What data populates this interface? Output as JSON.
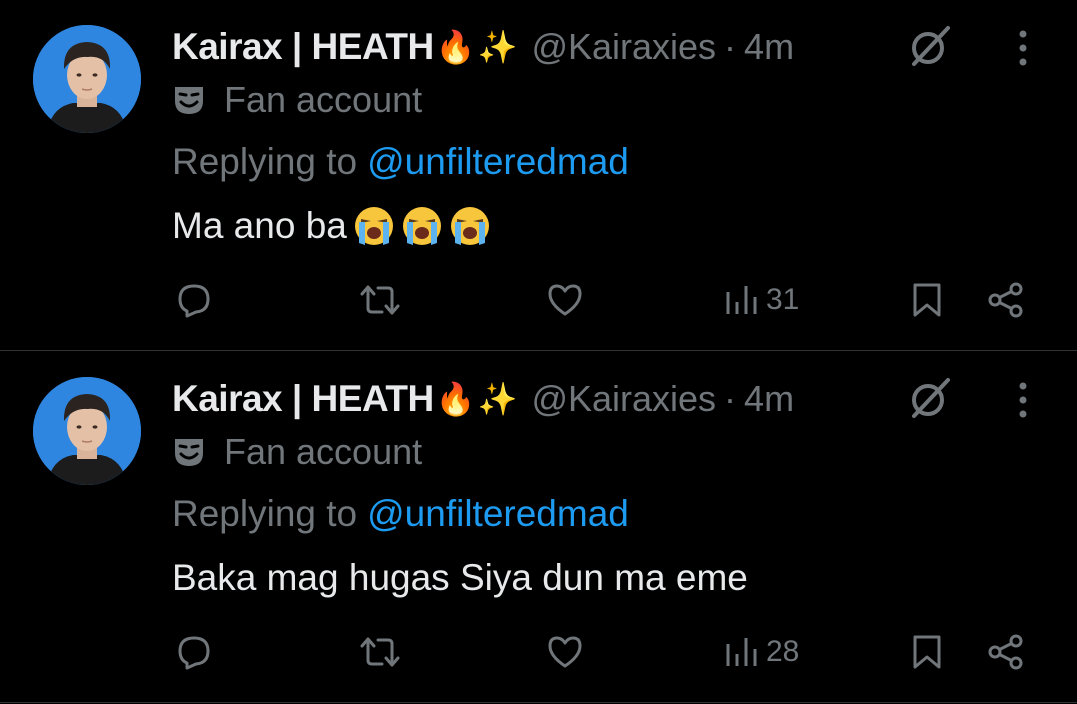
{
  "tweets": [
    {
      "display_name": "Kairax | HEATH",
      "name_emojis": [
        "🔥",
        "✨"
      ],
      "handle": "@Kairaxies",
      "separator": "·",
      "time": "4m",
      "label": "Fan account",
      "reply_prefix": "Replying to",
      "reply_handle": "@unfilteredmad",
      "text": "Ma ano ba",
      "text_emojis": [
        "loudly-crying-face",
        "loudly-crying-face",
        "loudly-crying-face"
      ],
      "views": "31"
    },
    {
      "display_name": "Kairax | HEATH",
      "name_emojis": [
        "🔥",
        "✨"
      ],
      "handle": "@Kairaxies",
      "separator": "·",
      "time": "4m",
      "label": "Fan account",
      "reply_prefix": "Replying to",
      "reply_handle": "@unfilteredmad",
      "text": "Baka mag hugas Siya dun ma eme",
      "text_emojis": [],
      "views": "28"
    }
  ],
  "icons": {
    "grok": "grok-icon",
    "more": "more-vertical-icon",
    "label": "fan-account-mask-icon",
    "reply": "reply-icon",
    "retweet": "retweet-icon",
    "like": "heart-icon",
    "views": "views-icon",
    "bookmark": "bookmark-icon",
    "share": "share-icon"
  },
  "colors": {
    "background": "#000000",
    "primary_text": "#e7e9ea",
    "secondary_text": "#71767b",
    "link": "#1d9bf0",
    "avatar_bg": "#2f86e0"
  }
}
